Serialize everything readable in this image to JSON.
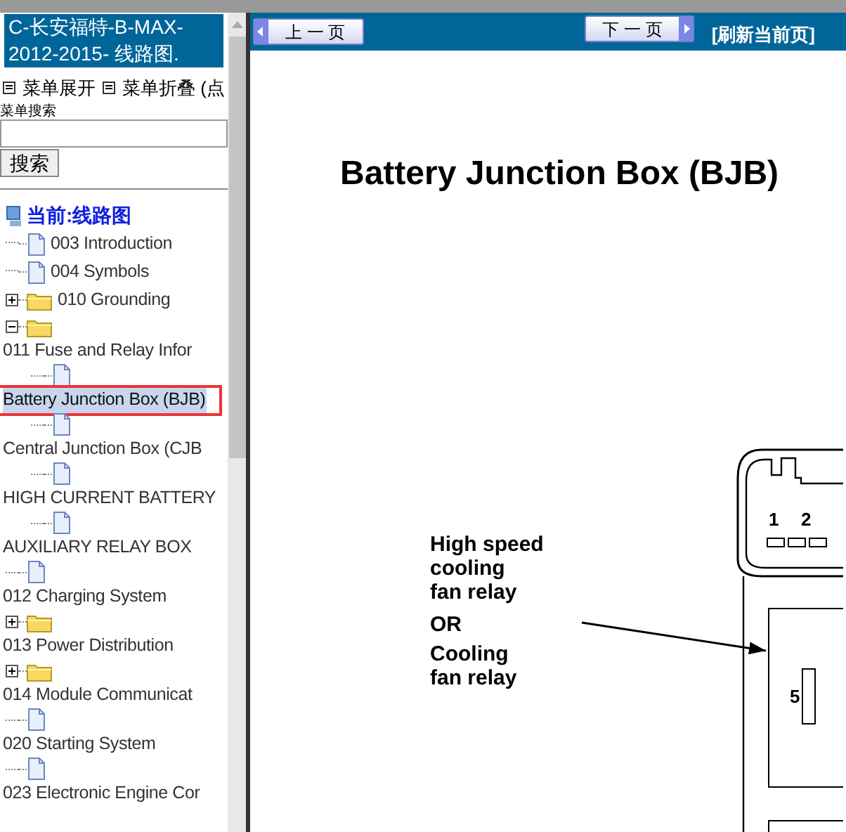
{
  "sidebar": {
    "title": "C-长安福特-B-MAX-2012-2015- 线路图.",
    "menu_toggles": [
      {
        "label": "菜单展开"
      },
      {
        "label": "菜单折叠 (点"
      }
    ],
    "search": {
      "label": "菜单搜索",
      "button": "搜索"
    },
    "tree": {
      "root": "当前:线路图",
      "items": [
        {
          "label": "003 Introduction",
          "kind": "leaf",
          "selected": false
        },
        {
          "label": "004 Symbols",
          "kind": "leaf",
          "selected": false
        },
        {
          "label": "010 Grounding",
          "kind": "branch",
          "expanded": false,
          "selected": false
        },
        {
          "label": "011 Fuse and Relay Infor",
          "kind": "folder",
          "expanded": true,
          "selected": false,
          "children": [
            {
              "label": "Battery Junction Box (BJB)",
              "kind": "page",
              "selected": true
            },
            {
              "label": "Central Junction Box (CJB",
              "kind": "page",
              "selected": false
            },
            {
              "label": "HIGH CURRENT BATTERY",
              "kind": "page",
              "selected": false
            },
            {
              "label": "AUXILIARY RELAY BOX",
              "kind": "page",
              "selected": false
            }
          ]
        },
        {
          "label": "012 Charging System",
          "kind": "page",
          "selected": false
        },
        {
          "label": "013 Power Distribution",
          "kind": "folder",
          "expanded": false,
          "selected": false
        },
        {
          "label": "014 Module Communicat",
          "kind": "folder",
          "expanded": false,
          "selected": false
        },
        {
          "label": "020 Starting System",
          "kind": "page",
          "selected": false
        },
        {
          "label": "023 Electronic Engine Cor",
          "kind": "page",
          "selected": false
        }
      ]
    }
  },
  "toolbar": {
    "prev": "上 一 页",
    "next": "下 一 页",
    "refresh": "[刷新当前页]"
  },
  "document": {
    "title": "Battery Junction Box (BJB)",
    "callout": [
      "High speed",
      "cooling",
      "fan relay",
      "OR",
      "Cooling",
      "fan relay"
    ],
    "pins": [
      "1",
      "2",
      "5"
    ]
  }
}
